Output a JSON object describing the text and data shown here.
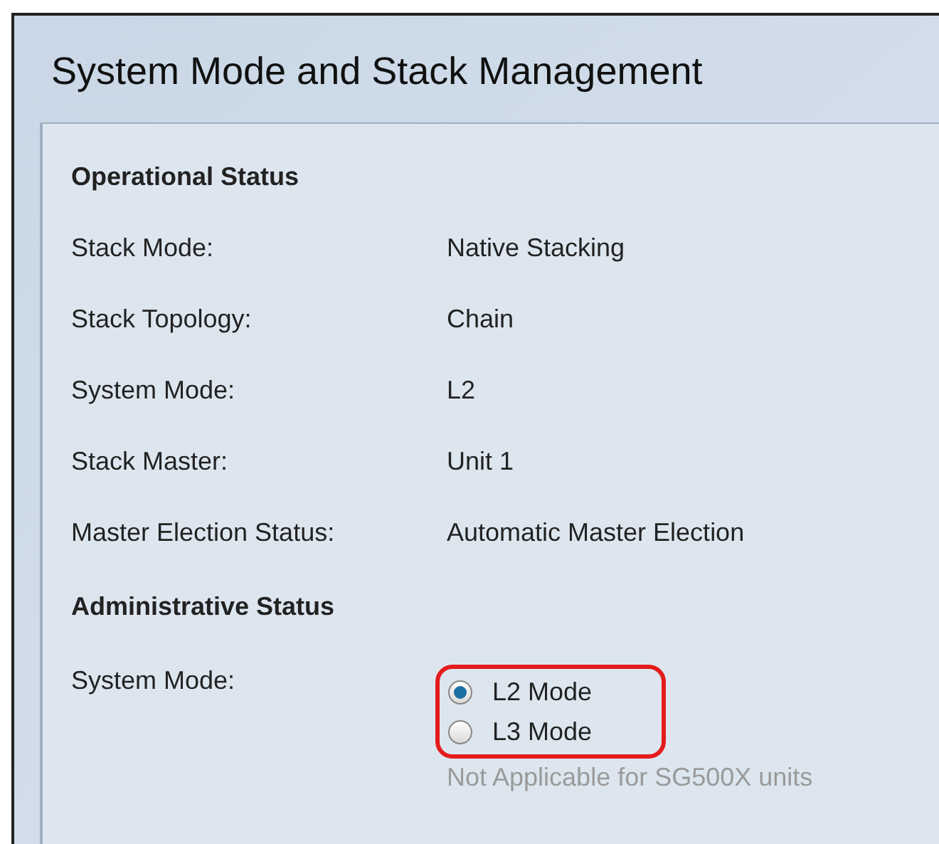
{
  "title": "System Mode and Stack Management",
  "operational_status": {
    "heading": "Operational Status",
    "rows": [
      {
        "label": "Stack Mode:",
        "value": "Native Stacking"
      },
      {
        "label": "Stack Topology:",
        "value": "Chain"
      },
      {
        "label": "System Mode:",
        "value": "L2"
      },
      {
        "label": "Stack Master:",
        "value": "Unit 1"
      },
      {
        "label": "Master Election Status:",
        "value": "Automatic Master Election"
      }
    ]
  },
  "administrative_status": {
    "heading": "Administrative Status",
    "label": "System Mode:",
    "highlighted": true,
    "options": [
      {
        "label": "L2 Mode",
        "selected": true
      },
      {
        "label": "L3 Mode",
        "selected": false
      }
    ],
    "note": "Not Applicable for SG500X units"
  }
}
